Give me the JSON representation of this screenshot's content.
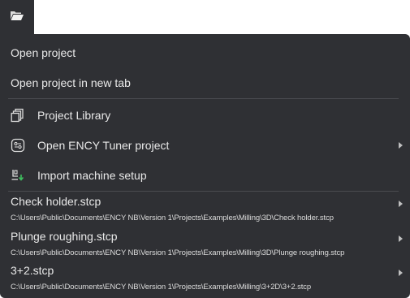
{
  "toolbar": {
    "open_icon": "folder-open-icon"
  },
  "menu": {
    "open_project": "Open project",
    "open_project_new_tab": "Open project in new tab",
    "project_library": "Project Library",
    "open_tuner_project": "Open ENCY Tuner project",
    "import_machine_setup": "Import machine setup",
    "recent": [
      {
        "title": "Check holder.stcp",
        "path": "C:\\Users\\Public\\Documents\\ENCY NB\\Version 1\\Projects\\Examples\\Milling\\3D\\Check holder.stcp"
      },
      {
        "title": "Plunge roughing.stcp",
        "path": "C:\\Users\\Public\\Documents\\ENCY NB\\Version 1\\Projects\\Examples\\Milling\\3D\\Plunge roughing.stcp"
      },
      {
        "title": "3+2.stcp",
        "path": "C:\\Users\\Public\\Documents\\ENCY NB\\Version 1\\Projects\\Examples\\Milling\\3+2D\\3+2.stcp"
      }
    ]
  },
  "colors": {
    "menu_bg": "#2f3034",
    "text": "#e9e9e9",
    "separator": "#4a4b50",
    "icon_accent": "#3fbf5f"
  }
}
